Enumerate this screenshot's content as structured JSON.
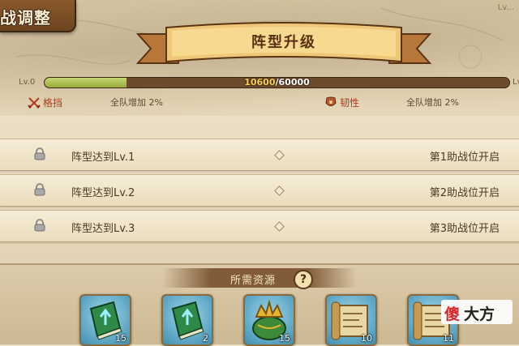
{
  "header": {
    "title_tab": "战调整",
    "corner_text": "Lv..."
  },
  "ribbon": {
    "title": "阵型升级"
  },
  "progress": {
    "level_left": "Lv.0",
    "level_right": "Lv",
    "current": "10600",
    "separator": "/",
    "max": "60000",
    "fraction": 0.1767
  },
  "stats": [
    {
      "icon": "crossed-swords-icon",
      "name": "格挡",
      "value": "全队增加 2%"
    },
    {
      "icon": "armor-icon",
      "name": "韧性",
      "value": "全队增加 2%"
    }
  ],
  "unlocks": [
    {
      "condition": "阵型达到Lv.1",
      "reward": "第1助战位开启"
    },
    {
      "condition": "阵型达到Lv.2",
      "reward": "第2助战位开启"
    },
    {
      "condition": "阵型达到Lv.3",
      "reward": "第3助战位开启"
    }
  ],
  "resources": {
    "title": "所需资源",
    "help_label": "?",
    "items": [
      {
        "icon": "green-book-icon",
        "count": "15"
      },
      {
        "icon": "green-book-icon",
        "count": "2"
      },
      {
        "icon": "crown-icon",
        "count": "15"
      },
      {
        "icon": "scroll-map-icon",
        "count": "10"
      },
      {
        "icon": "scroll-map-icon",
        "count": "11"
      }
    ]
  },
  "watermark": {
    "part1": "傻",
    "part2": "大方"
  },
  "colors": {
    "bar_fill": "#a6bb45",
    "bar_track": "#6e4a2c",
    "stat_name": "#b23a1a",
    "current_value": "#ffd34a"
  }
}
